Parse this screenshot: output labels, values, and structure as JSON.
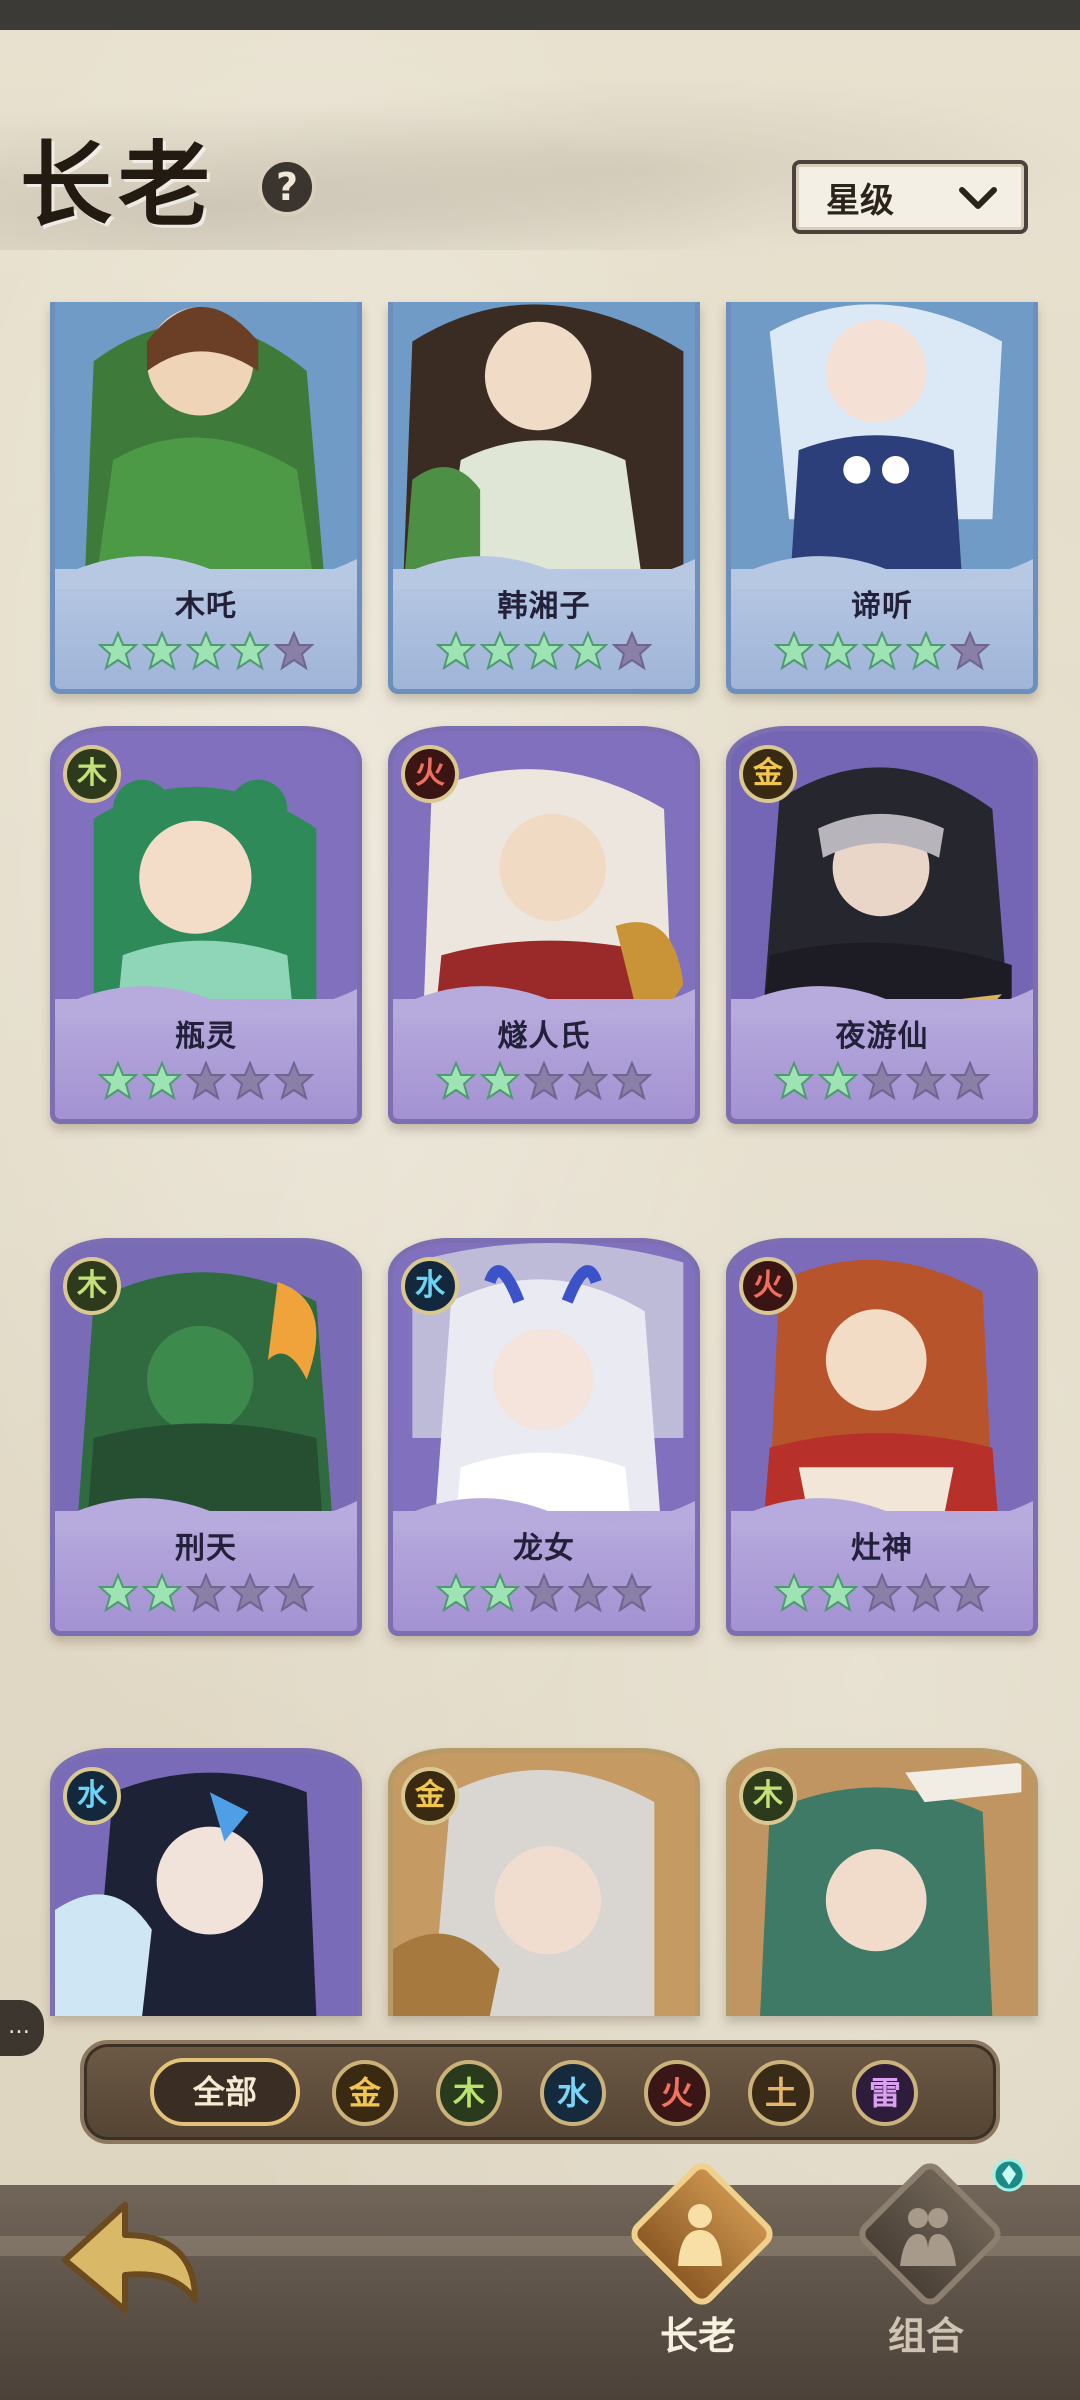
{
  "header": {
    "title": "长老",
    "help_label": "?"
  },
  "sort": {
    "label": "星级"
  },
  "cards": [
    {
      "name": "木吒",
      "element": "",
      "stars": 4,
      "max_stars": 5
    },
    {
      "name": "韩湘子",
      "element": "",
      "stars": 4,
      "max_stars": 5
    },
    {
      "name": "谛听",
      "element": "",
      "stars": 4,
      "max_stars": 5
    },
    {
      "name": "瓶灵",
      "element": "木",
      "stars": 2,
      "max_stars": 5
    },
    {
      "name": "燧人氏",
      "element": "火",
      "stars": 2,
      "max_stars": 5
    },
    {
      "name": "夜游仙",
      "element": "金",
      "stars": 2,
      "max_stars": 5
    },
    {
      "name": "刑天",
      "element": "木",
      "stars": 2,
      "max_stars": 5
    },
    {
      "name": "龙女",
      "element": "水",
      "stars": 2,
      "max_stars": 5
    },
    {
      "name": "灶神",
      "element": "火",
      "stars": 2,
      "max_stars": 5
    },
    {
      "name": "",
      "element": "水",
      "stars": 0,
      "max_stars": 5
    },
    {
      "name": "",
      "element": "金",
      "stars": 0,
      "max_stars": 5
    },
    {
      "name": "",
      "element": "木",
      "stars": 0,
      "max_stars": 5
    }
  ],
  "filters": {
    "all_label": "全部",
    "metal": "金",
    "wood": "木",
    "water": "水",
    "fire": "火",
    "earth": "土",
    "thunder": "雷"
  },
  "nav": {
    "elder_label": "长老",
    "combo_label": "组合"
  },
  "colors": {
    "star_filled": "#9ee3b4",
    "star_empty": "#8a7fa6",
    "card_purple": "#7b6ab8",
    "card_blue": "#6f93c2"
  }
}
